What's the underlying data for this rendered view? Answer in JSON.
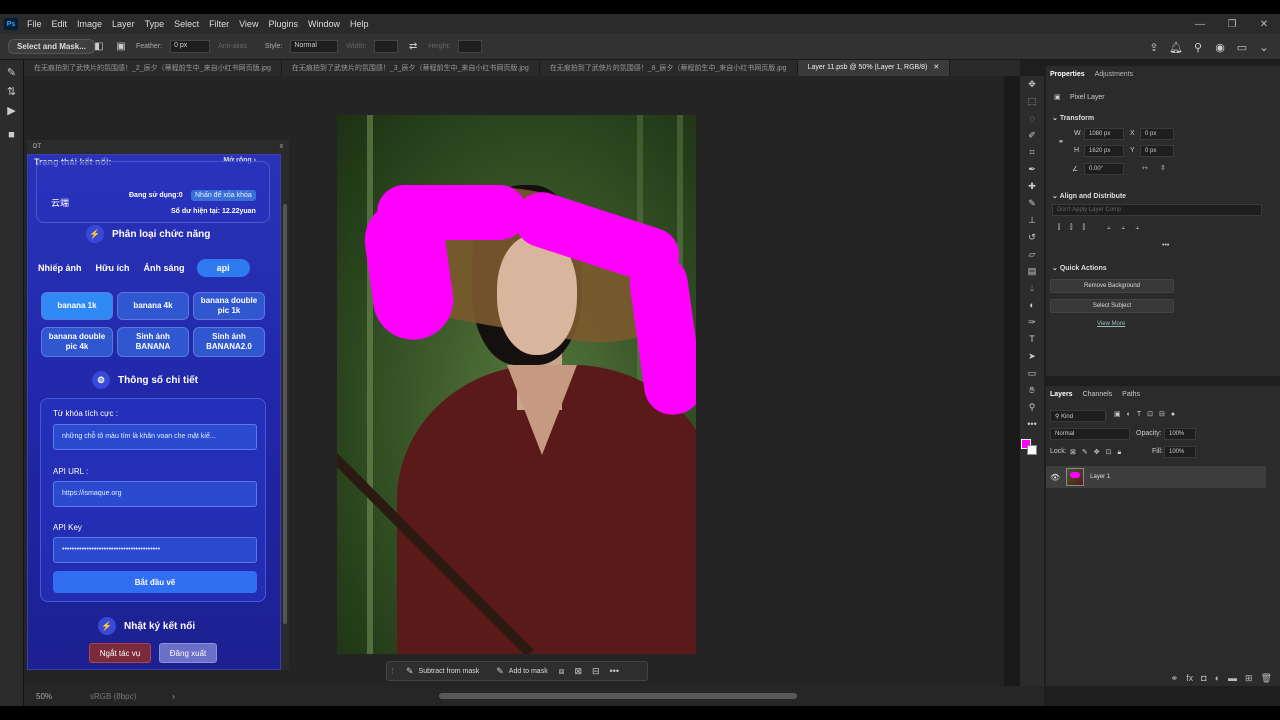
{
  "menu": {
    "logo": "Ps",
    "items": [
      "File",
      "Edit",
      "Image",
      "Layer",
      "Type",
      "Select",
      "Filter",
      "View",
      "Plugins",
      "Window",
      "Help"
    ]
  },
  "options": {
    "feather_label": "Feather:",
    "feather_value": "0 px",
    "antialias": "Anti-alias",
    "style_label": "Style:",
    "style_value": "Normal",
    "width_label": "Width:",
    "height_label": "Height:",
    "mask_btn": "Select and Mask..."
  },
  "tabs": [
    {
      "label": "在无痕拍到了武侠片的氛围感！_2_辰夕（蒂程前生中_来自小红书网页版.jpg"
    },
    {
      "label": "在无痕拍到了武侠片的氛围感！_3_辰夕（蒂程前生中_来自小红书网页版.jpg"
    },
    {
      "label": "在无痕拍到了武侠片的氛围感！_8_辰夕（蒂程前生中_来自小红书网页版.jpg"
    },
    {
      "label": "Layer 11.psb @ 50% (Layer 1, RGB/8)"
    }
  ],
  "plugin": {
    "header": "DT",
    "status_label": "Trạng thái kết nối:",
    "status_value": "",
    "mode": "Mở rộng",
    "cloud": "云端",
    "in_use": "Đang sử dụng:0",
    "badge": "Nhấn để xóa khóa",
    "balance": "Số dư hiện tại: 12.22yuan",
    "section_category": "Phân loại chức năng",
    "categories": [
      "Nhiếp ảnh",
      "Hữu ích",
      "Ánh sáng",
      "api"
    ],
    "buttons": [
      "banana 1k",
      "banana 4k",
      "banana double pic 1k",
      "banana double pic 4k",
      "Sinh ảnh BANANA",
      "Sinh ảnh BANANA2.0"
    ],
    "section_params": "Thông số chi tiết",
    "prompt_label": "Từ khóa tích cực :",
    "prompt_value": "những chỗ tô màu tím là khăn voan che mặt kiể...",
    "api_url_label": "API URL :",
    "api_url_value": "https://ismaque.org",
    "api_key_label": "API Key",
    "api_key_value": "••••••••••••••••••••••••••••••••••••••••",
    "start": "Bắt đầu vẽ",
    "section_log": "Nhật ký kết nối",
    "stop": "Ngắt tác vụ",
    "logout": "Đăng xuất"
  },
  "maskbar": {
    "subtract": "Subtract from mask",
    "add": "Add to mask"
  },
  "statusbar": {
    "zoom": "50%",
    "profile": "sRGB (8bpc)"
  },
  "properties": {
    "tabs": [
      "Properties",
      "Adjustments"
    ],
    "pixel_layer": "Pixel Layer",
    "transform": "Transform",
    "w_label": "W",
    "w_value": "1080 px",
    "x_label": "X",
    "x_value": "0 px",
    "h_label": "H",
    "h_value": "1620 px",
    "y_label": "Y",
    "y_value": "0 px",
    "angle": "0.00°",
    "align": "Align and Distribute",
    "layer_comp": "Don't Apply Layer Comp",
    "quick_actions": "Quick Actions",
    "remove_bg": "Remove Background",
    "select_subject": "Select Subject",
    "view_more": "View More"
  },
  "layers": {
    "tabs": [
      "Layers",
      "Channels",
      "Paths"
    ],
    "kind": "Kind",
    "blend": "Normal",
    "opacity_label": "Opacity:",
    "opacity": "100%",
    "lock_label": "Lock:",
    "fill_label": "Fill:",
    "fill": "100%",
    "layer_name": "Layer 1"
  },
  "colors": {
    "foreground": "#ff00ff",
    "background": "#ffffff",
    "accent": "#2f7af0"
  }
}
